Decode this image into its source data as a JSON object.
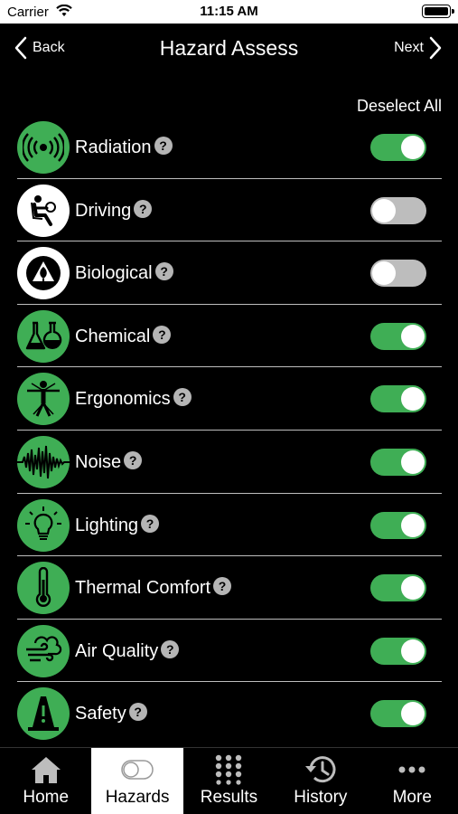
{
  "status_bar": {
    "carrier": "Carrier",
    "time": "11:15 AM"
  },
  "nav": {
    "back_label": "Back",
    "title": "Hazard Assess",
    "next_label": "Next"
  },
  "deselect_all_label": "Deselect All",
  "help_glyph": "?",
  "hazards": [
    {
      "label": "Radiation",
      "icon": "radiation-icon",
      "icon_bg": "green",
      "enabled": true
    },
    {
      "label": "Driving",
      "icon": "driving-icon",
      "icon_bg": "white",
      "enabled": false
    },
    {
      "label": "Biological",
      "icon": "biological-icon",
      "icon_bg": "white",
      "enabled": false
    },
    {
      "label": "Chemical",
      "icon": "chemical-icon",
      "icon_bg": "green",
      "enabled": true
    },
    {
      "label": "Ergonomics",
      "icon": "ergonomics-icon",
      "icon_bg": "green",
      "enabled": true
    },
    {
      "label": "Noise",
      "icon": "noise-icon",
      "icon_bg": "green",
      "enabled": true
    },
    {
      "label": "Lighting",
      "icon": "lighting-icon",
      "icon_bg": "green",
      "enabled": true
    },
    {
      "label": "Thermal Comfort",
      "icon": "thermal-comfort-icon",
      "icon_bg": "green",
      "enabled": true
    },
    {
      "label": "Air Quality",
      "icon": "air-quality-icon",
      "icon_bg": "green",
      "enabled": true
    },
    {
      "label": "Safety",
      "icon": "safety-icon",
      "icon_bg": "green",
      "enabled": true
    }
  ],
  "tabs": [
    {
      "label": "Home",
      "icon": "home-icon",
      "active": false
    },
    {
      "label": "Hazards",
      "icon": "toggle-icon",
      "active": true
    },
    {
      "label": "Results",
      "icon": "grid-icon",
      "active": false
    },
    {
      "label": "History",
      "icon": "history-icon",
      "active": false
    },
    {
      "label": "More",
      "icon": "more-icon",
      "active": false
    }
  ],
  "colors": {
    "accent_green": "#3fae55",
    "toggle_off": "#bdbdbd",
    "background": "#000000"
  }
}
